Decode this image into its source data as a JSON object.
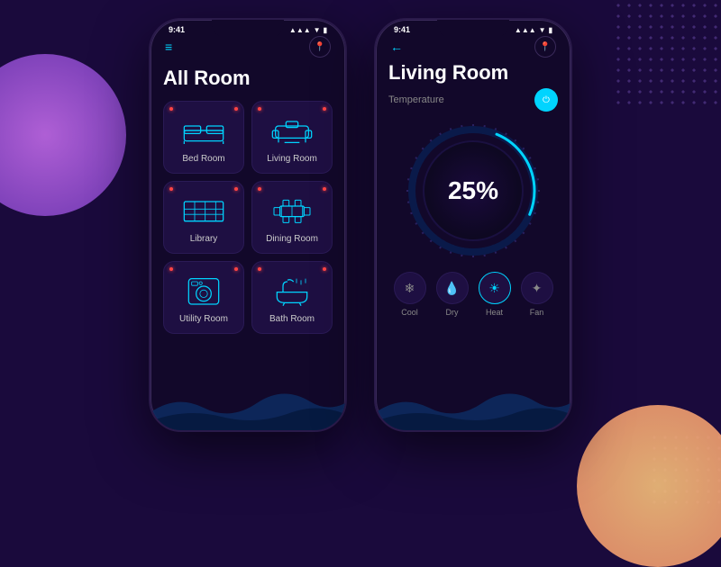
{
  "background": {
    "color": "#1a0a3c"
  },
  "phone1": {
    "status_time": "9:41",
    "title": "All Room",
    "nav_icon": "📍",
    "rooms": [
      {
        "id": "bedroom",
        "label": "Bed Room",
        "icon": "bed"
      },
      {
        "id": "livingroom",
        "label": "Living Room",
        "icon": "sofa"
      },
      {
        "id": "library",
        "label": "Library",
        "icon": "bookshelf"
      },
      {
        "id": "diningroom",
        "label": "Dining Room",
        "icon": "dining"
      },
      {
        "id": "utilityroom",
        "label": "Utility Room",
        "icon": "washer"
      },
      {
        "id": "bathroom",
        "label": "Bath Room",
        "icon": "bath"
      }
    ]
  },
  "phone2": {
    "status_time": "9:41",
    "title": "Living Room",
    "temp_label": "Temperature",
    "percent": "25%",
    "controls": [
      {
        "id": "cool",
        "label": "Cool",
        "active": false
      },
      {
        "id": "dry",
        "label": "Dry",
        "active": false
      },
      {
        "id": "heat",
        "label": "Heat",
        "active": true
      },
      {
        "id": "fan",
        "label": "Fan",
        "active": false
      }
    ]
  }
}
